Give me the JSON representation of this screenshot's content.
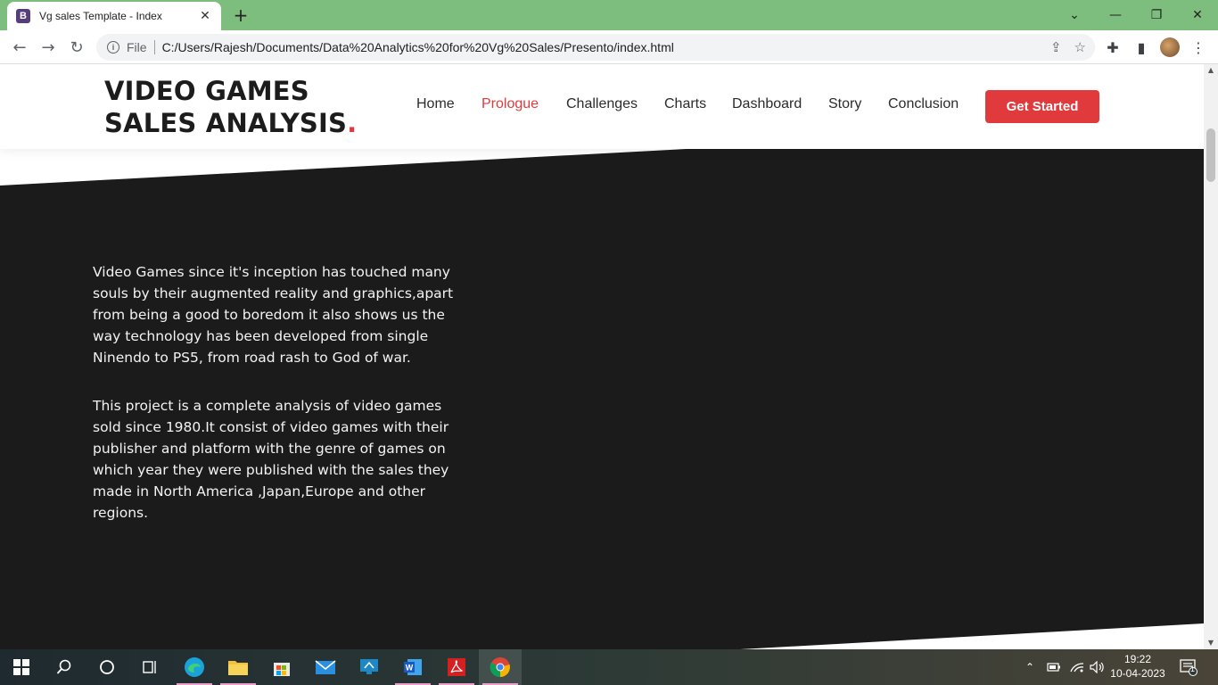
{
  "browser": {
    "tab_title": "Vg sales Template - Index",
    "tab_favicon_letter": "B",
    "file_label": "File",
    "url": "C:/Users/Rajesh/Documents/Data%20Analytics%20for%20Vg%20Sales/Presento/index.html",
    "icons": [
      "back-icon",
      "forward-icon",
      "reload-icon",
      "info-icon",
      "share-icon",
      "star-icon",
      "extensions-icon",
      "sidepanel-icon",
      "menu-icon"
    ]
  },
  "site": {
    "brand_text": "VIDEO GAMES SALES ANALYSIS",
    "brand_dot": ".",
    "nav": [
      {
        "label": "Home",
        "active": false
      },
      {
        "label": "Prologue",
        "active": true
      },
      {
        "label": "Challenges",
        "active": false
      },
      {
        "label": "Charts",
        "active": false
      },
      {
        "label": "Dashboard",
        "active": false
      },
      {
        "label": "Story",
        "active": false
      },
      {
        "label": "Conclusion",
        "active": false
      }
    ],
    "cta_label": "Get Started",
    "accent_color": "#e03a3c",
    "section_bg": "#1b1b1b"
  },
  "content": {
    "paragraph_1": "Video Games since it's inception has touched many souls by their augmented reality and graphics,apart from being a good to boredom it also shows us the way technology has been developed from single Ninendo to PS5, from road rash to God of war.",
    "paragraph_2": "This project is a complete analysis of video games sold since 1980.It consist of video games with their publisher and platform with the genre of games on which year they were published with the sales they made in North America ,Japan,Europe and other regions."
  },
  "taskbar": {
    "time": "19:22",
    "date": "10-04-2023",
    "notification_count": "1",
    "apps": [
      "start-icon",
      "search-icon",
      "cortana-icon",
      "task-view-icon",
      "edge-icon",
      "file-explorer-icon",
      "store-icon",
      "mail-icon",
      "remote-desktop-icon",
      "word-icon",
      "acrobat-icon",
      "chrome-icon"
    ]
  }
}
